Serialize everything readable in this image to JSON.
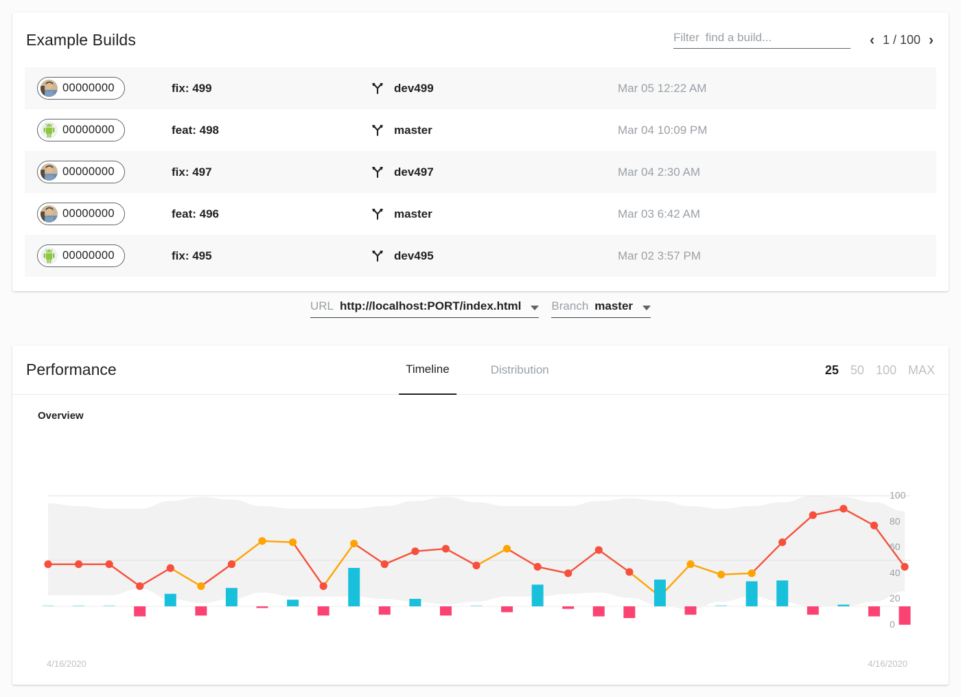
{
  "builds": {
    "title": "Example Builds",
    "filter": {
      "label": "Filter",
      "value": "",
      "placeholder": "find a build..."
    },
    "pager": {
      "prev_icon": "chevron-left-icon",
      "next_icon": "chevron-right-icon",
      "text": "1 / 100"
    },
    "rows": [
      {
        "avatar": "photo-avatar",
        "hash": "00000000",
        "message": "fix: 499",
        "branch_icon": "git-branch-icon",
        "branch": "dev499",
        "date": "Mar 05 12:22 AM"
      },
      {
        "avatar": "android-avatar",
        "hash": "00000000",
        "message": "feat: 498",
        "branch_icon": "git-branch-icon",
        "branch": "master",
        "date": "Mar 04 10:09 PM"
      },
      {
        "avatar": "photo-avatar",
        "hash": "00000000",
        "message": "fix: 497",
        "branch_icon": "git-branch-icon",
        "branch": "dev497",
        "date": "Mar 04 2:30 AM"
      },
      {
        "avatar": "photo-avatar",
        "hash": "00000000",
        "message": "feat: 496",
        "branch_icon": "git-branch-icon",
        "branch": "master",
        "date": "Mar 03 6:42 AM"
      },
      {
        "avatar": "android-avatar",
        "hash": "00000000",
        "message": "fix: 495",
        "branch_icon": "git-branch-icon",
        "branch": "dev495",
        "date": "Mar 02 3:57 PM"
      }
    ]
  },
  "selectors": {
    "url": {
      "label": "URL",
      "value": "http://localhost:PORT/index.html",
      "caret_icon": "chevron-down-icon"
    },
    "branch": {
      "label": "Branch",
      "value": "master",
      "caret_icon": "chevron-down-icon"
    }
  },
  "performance": {
    "title": "Performance",
    "tabs": [
      {
        "label": "Timeline",
        "active": true
      },
      {
        "label": "Distribution",
        "active": false
      }
    ],
    "counts": [
      {
        "label": "25",
        "active": true
      },
      {
        "label": "50",
        "active": false
      },
      {
        "label": "100",
        "active": false
      },
      {
        "label": "MAX",
        "active": false
      }
    ],
    "overview_label": "Overview",
    "date_left": "4/16/2020",
    "date_right": "4/16/2020"
  },
  "colors": {
    "line_low": "#F6503C",
    "line_high": "#FFA300",
    "band": "#F2F2F2",
    "bar_positive": "#19C0DC",
    "bar_negative": "#FA4373",
    "gridline": "#E0E0E0",
    "text_primary": "#202124",
    "text_muted": "#9aa0a6"
  },
  "chart_data": {
    "type": "line",
    "title": "Overview",
    "xlabel": "",
    "ylabel": "",
    "ylim": [
      0,
      100
    ],
    "yticks": [
      100,
      80,
      60,
      40,
      20,
      0
    ],
    "grid": true,
    "x_axis_labels": {
      "start": "4/16/2020",
      "end": "4/16/2020"
    },
    "series": [
      {
        "name": "score",
        "point_colors": [
          "#F6503C",
          "#F6503C",
          "#F6503C",
          "#F6503C",
          "#F6503C",
          "#FFA300",
          "#F6503C",
          "#FFA300",
          "#FFA300",
          "#F6503C",
          "#FFA300",
          "#F6503C",
          "#F6503C",
          "#F6503C",
          "#F6503C",
          "#FFA300",
          "#F6503C",
          "#F6503C",
          "#F6503C",
          "#F6503C",
          "#FFA300",
          "#FFA300",
          "#FFA300",
          "#FFA300",
          "#F6503C"
        ],
        "values": [
          47,
          47,
          47,
          30,
          44,
          30,
          47,
          65,
          64,
          30,
          63,
          47,
          57,
          59,
          46,
          59,
          45,
          40,
          58,
          41,
          22,
          47,
          39,
          40,
          64,
          85,
          90,
          77,
          45
        ]
      }
    ],
    "band": {
      "name": "distribution-band",
      "upper": [
        94,
        92,
        90,
        90,
        96,
        99,
        97,
        92,
        90,
        90,
        90,
        92,
        96,
        99,
        95,
        92,
        92,
        92,
        96,
        98,
        96,
        92,
        90,
        92,
        95,
        100,
        99,
        95,
        88
      ],
      "lower": [
        23,
        23,
        23,
        28,
        20,
        17,
        20,
        25,
        22,
        22,
        22,
        20,
        18,
        16,
        18,
        22,
        22,
        24,
        25,
        21,
        15,
        12,
        18,
        22,
        18,
        14,
        14,
        18,
        26
      ]
    },
    "bars": {
      "name": "delta",
      "values": [
        0,
        1,
        0.5,
        -12,
        15,
        -11,
        22,
        -2,
        8,
        -11,
        46,
        -10,
        9,
        -11,
        1,
        -7,
        26,
        -3,
        -12,
        -14,
        32,
        -10,
        1.5,
        30,
        31,
        -10,
        2,
        -12,
        -22
      ]
    }
  }
}
